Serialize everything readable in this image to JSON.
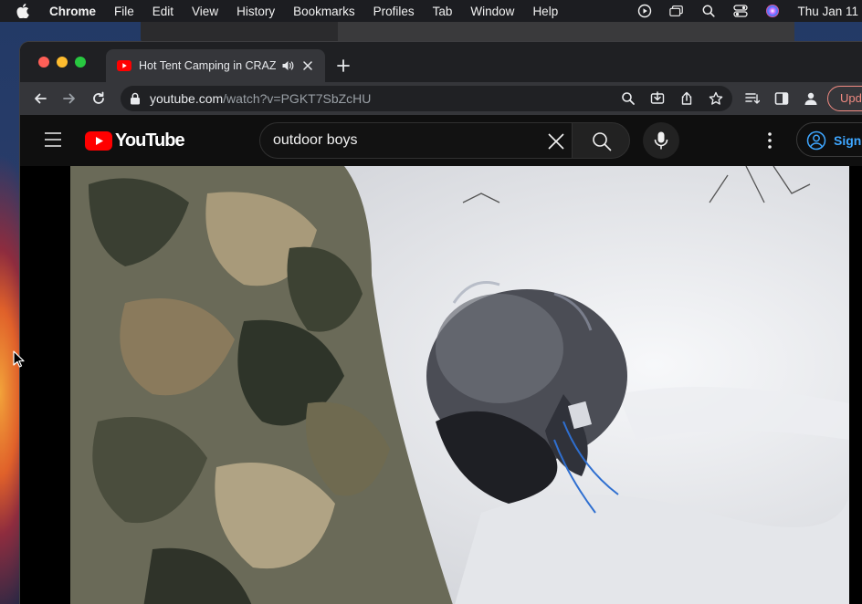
{
  "menubar": {
    "app_name": "Chrome",
    "items": [
      "File",
      "Edit",
      "View",
      "History",
      "Bookmarks",
      "Profiles",
      "Tab",
      "Window",
      "Help"
    ],
    "clock": "Thu Jan 11"
  },
  "browser": {
    "tab": {
      "title": "Hot Tent Camping in CRAZ"
    },
    "address": {
      "host": "youtube.com",
      "path": "/watch?v=PGKT7SbZcHU"
    },
    "update_label": "Upd"
  },
  "youtube": {
    "logo_text": "YouTube",
    "search": {
      "value": "outdoor boys"
    },
    "sign_in_label": "Sign"
  },
  "colors": {
    "yt_red": "#ff0000",
    "link_blue": "#3ea6ff",
    "update_pink": "#f28b82",
    "page_bg": "#0f0f0f"
  }
}
